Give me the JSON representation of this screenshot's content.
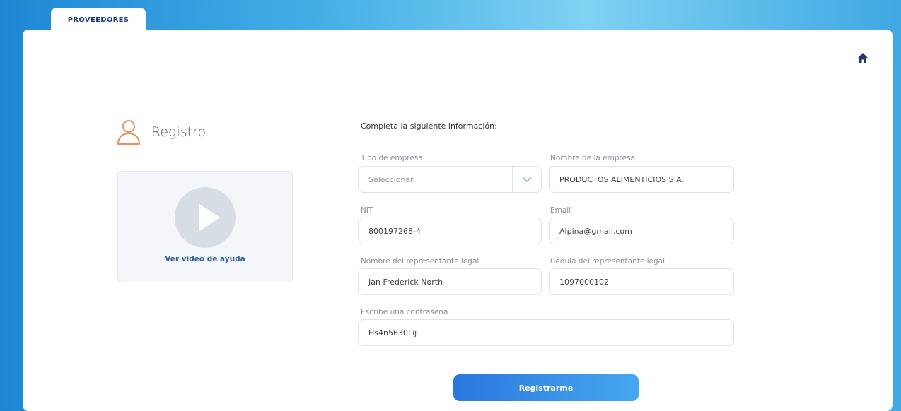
{
  "tab": {
    "label": "PROVEEDORES"
  },
  "registro": {
    "title": "Registro"
  },
  "video": {
    "link_text": "Ver video de ayuda"
  },
  "form": {
    "instructions": "Completa la siguiente información:",
    "fields": {
      "tipo_empresa": {
        "label": "Tipo de empresa",
        "value": "Seleccionar"
      },
      "nombre_empresa": {
        "label": "Nombre de la empresa",
        "value": "PRODUCTOS ALIMENTICIOS S.A."
      },
      "nit": {
        "label": "NIT",
        "value": "800197268-4"
      },
      "email": {
        "label": "Email",
        "value": "Alpina@gmail.com"
      },
      "representante": {
        "label": "Nombre del representante legal",
        "value": "Jan Frederick North"
      },
      "cedula": {
        "label": "Cédula del representante legal",
        "value": "1097000102"
      },
      "contrasena": {
        "label": "Escribe una contraseña",
        "value": "Hs4n5630Lij"
      }
    },
    "submit_label": "Registrarme"
  },
  "colors": {
    "accent": "#2a78df",
    "tab_text": "#1f3f7a",
    "user_icon": "#e9905c",
    "home_icon": "#1d3a6e"
  },
  "icons": [
    "home-icon",
    "user-icon",
    "play-icon",
    "chevron-down-icon"
  ]
}
